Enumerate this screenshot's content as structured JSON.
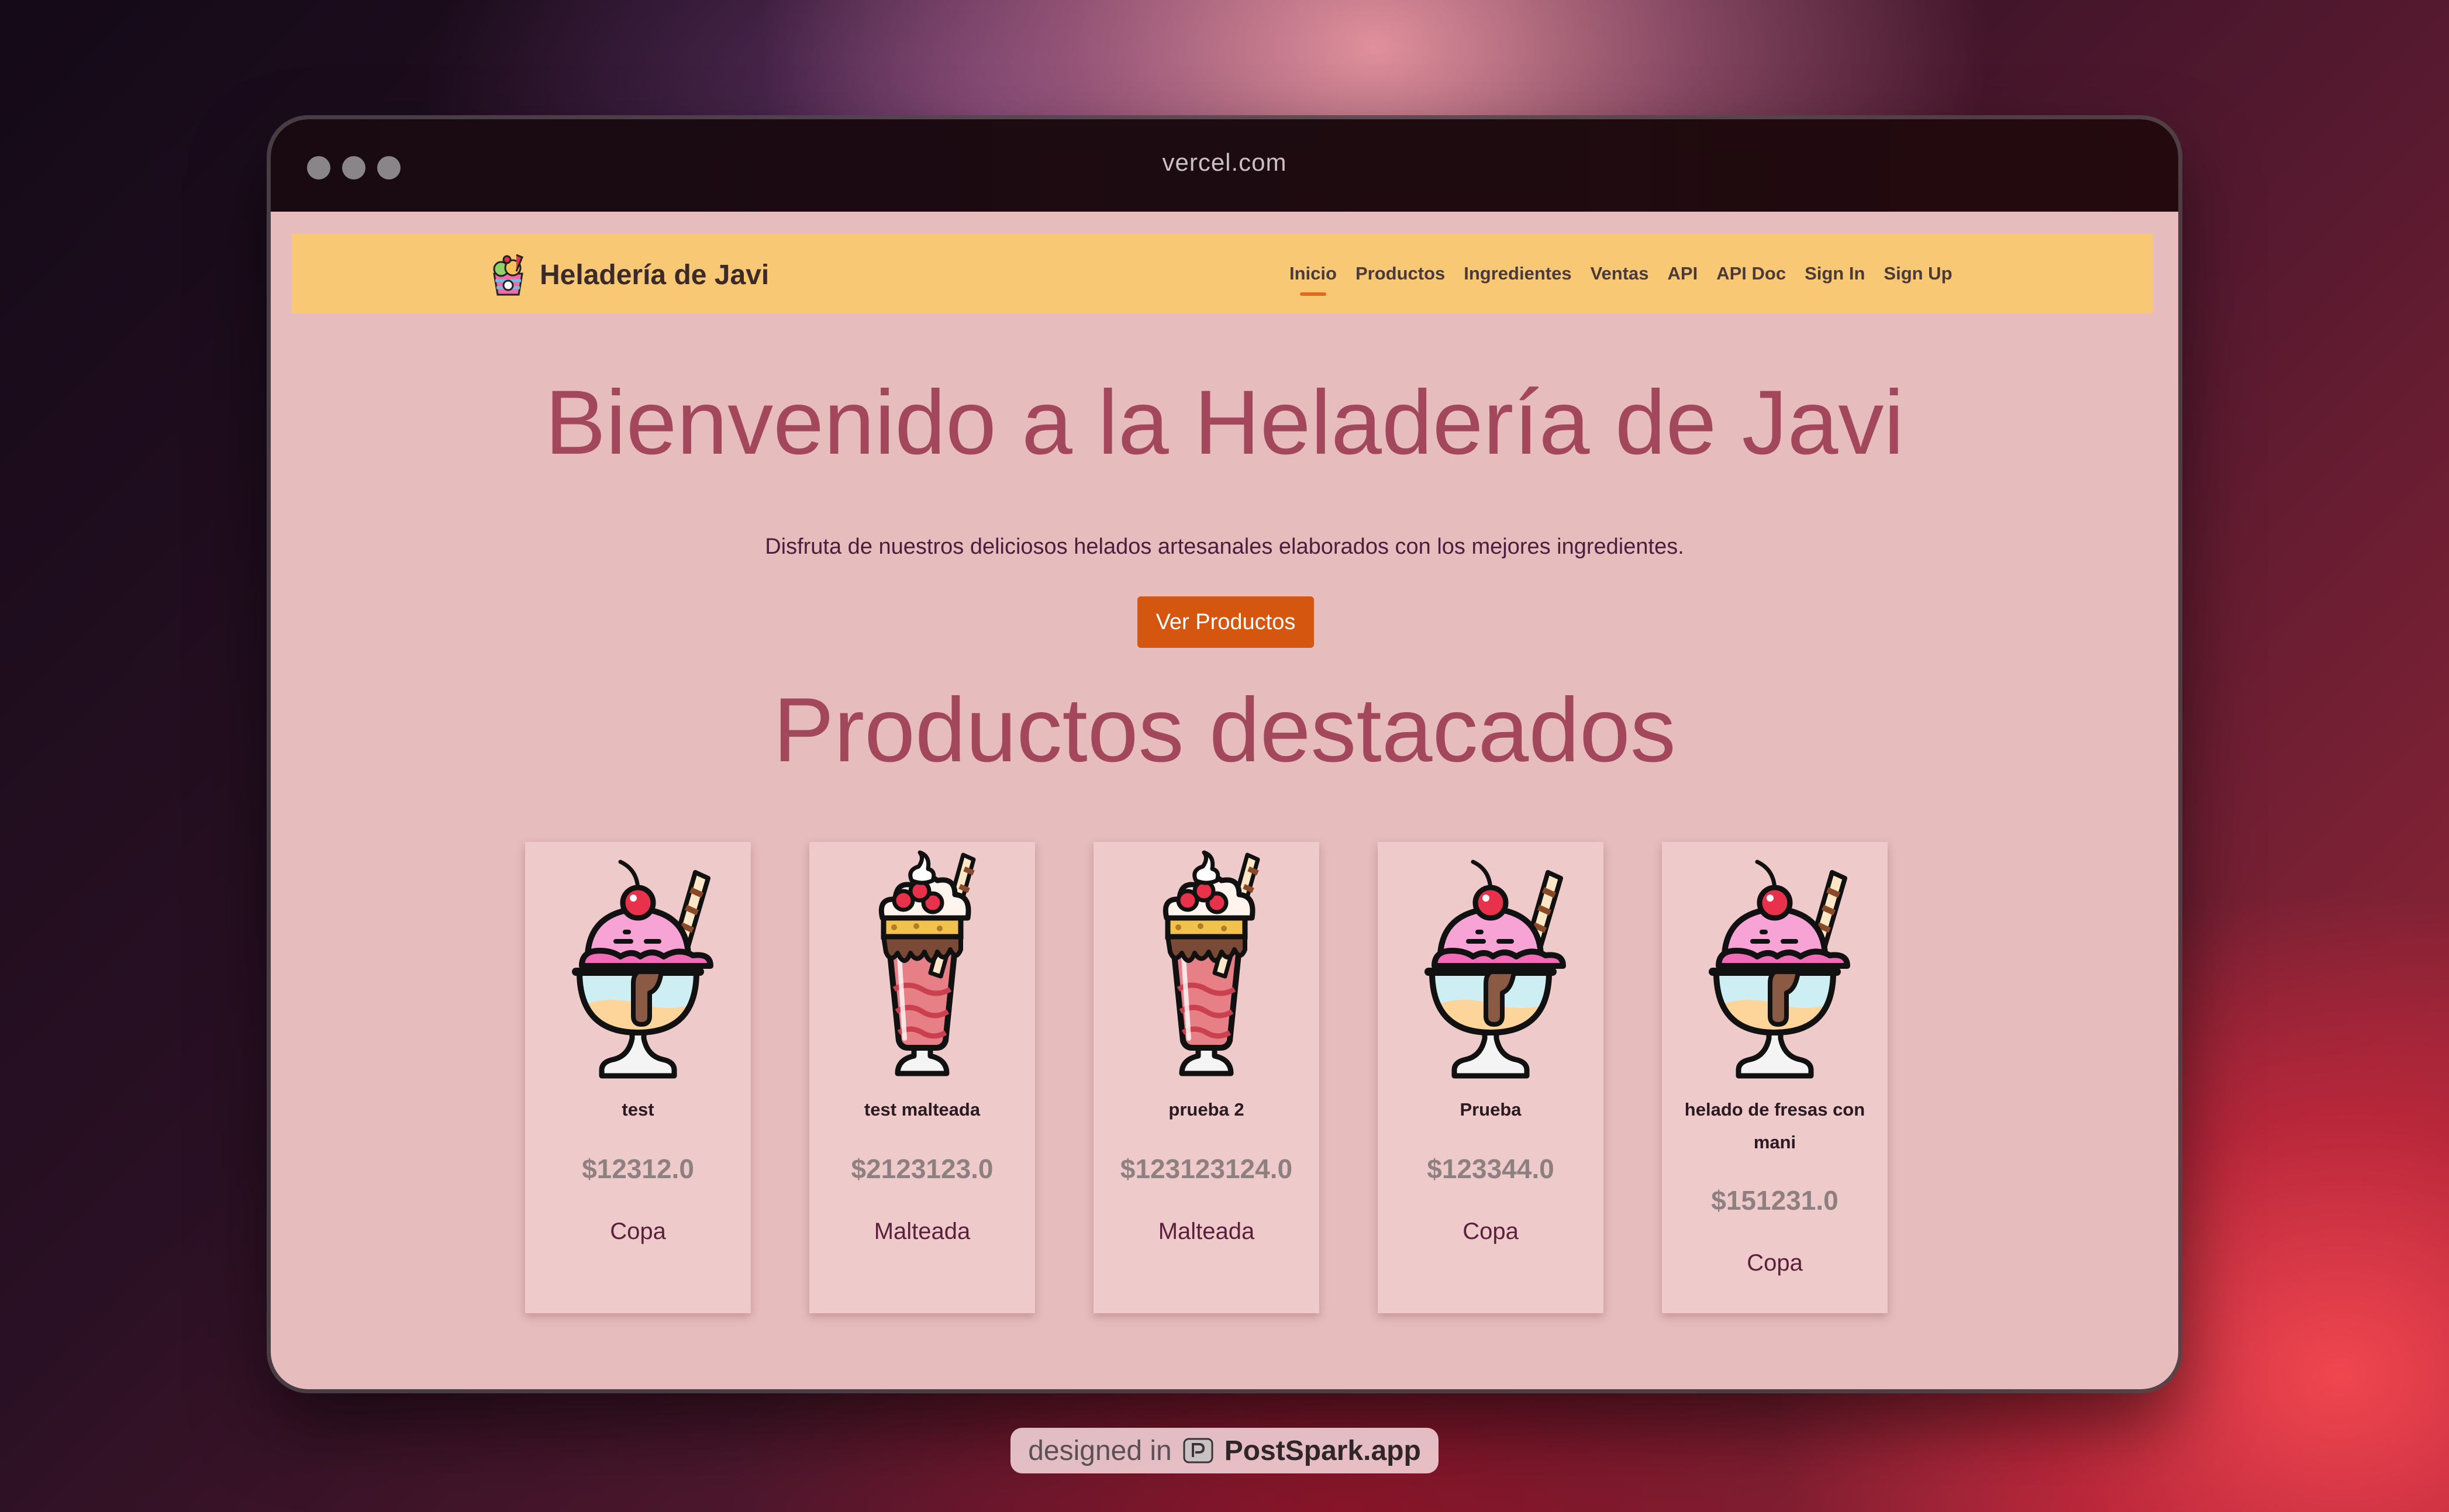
{
  "browser": {
    "url": "vercel.com"
  },
  "navbar": {
    "brand_name": "Heladería de Javi",
    "logo_icon": "ice-cream-cup-icon",
    "links": [
      {
        "label": "Inicio",
        "active": true
      },
      {
        "label": "Productos",
        "active": false
      },
      {
        "label": "Ingredientes",
        "active": false
      },
      {
        "label": "Ventas",
        "active": false
      },
      {
        "label": "API",
        "active": false
      },
      {
        "label": "API Doc",
        "active": false
      },
      {
        "label": "Sign In",
        "active": false
      },
      {
        "label": "Sign Up",
        "active": false
      }
    ]
  },
  "hero": {
    "title": "Bienvenido a la Heladería de Javi",
    "subtitle": "Disfruta de nuestros deliciosos helados artesanales elaborados con los mejores ingredientes.",
    "cta_label": "Ver Productos"
  },
  "featured": {
    "title": "Productos destacados",
    "products": [
      {
        "name": "test",
        "price": "$12312.0",
        "category": "Copa",
        "image": "sundae-cup-icon"
      },
      {
        "name": "test malteada",
        "price": "$2123123.0",
        "category": "Malteada",
        "image": "milkshake-icon"
      },
      {
        "name": "prueba 2",
        "price": "$123123124.0",
        "category": "Malteada",
        "image": "milkshake-icon"
      },
      {
        "name": "Prueba",
        "price": "$123344.0",
        "category": "Copa",
        "image": "sundae-cup-icon"
      },
      {
        "name": "helado de fresas con mani",
        "price": "$151231.0",
        "category": "Copa",
        "image": "sundae-cup-icon"
      }
    ]
  },
  "badge": {
    "prefix": "designed in",
    "name": "PostSpark.app"
  },
  "colors": {
    "navbar": "#f8c874",
    "page_bg": "#e6bcbc",
    "heading": "#a3485c",
    "cta": "#d5560f",
    "active_underline": "#e06a20"
  }
}
